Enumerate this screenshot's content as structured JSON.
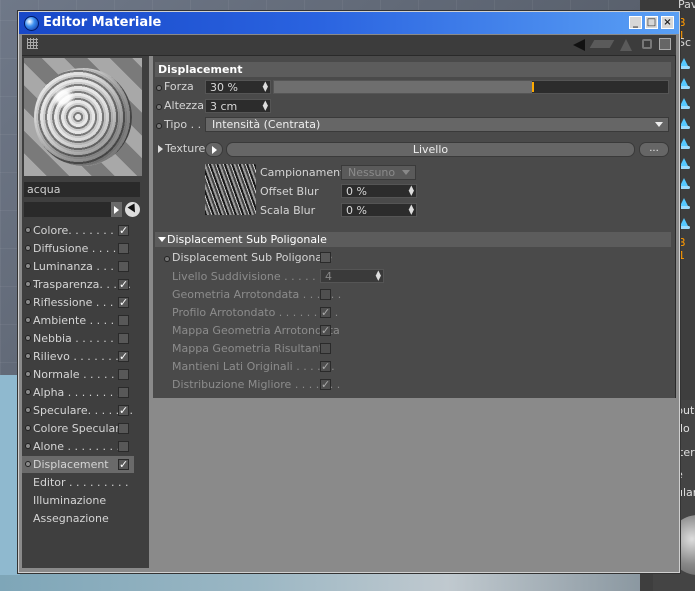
{
  "background": {
    "panel_top_text": "Pav",
    "panel_b_text_1": "B 1",
    "panel_sc_text": "Sc",
    "panel_b_text_2": "B 1",
    "lower_labels": [
      "buti",
      "do",
      "iteria",
      "e",
      "ulare"
    ]
  },
  "window": {
    "title": "Editor Materiale",
    "title_buttons": [
      "_",
      "□",
      "×"
    ]
  },
  "material": {
    "name": "acqua",
    "channels": [
      {
        "label": "Colore. . . . . . . . .",
        "checked": true
      },
      {
        "label": "Diffusione . . . . . .",
        "checked": false
      },
      {
        "label": "Luminanza . . . . . .",
        "checked": false
      },
      {
        "label": "Trasparenza. . . . .",
        "checked": true
      },
      {
        "label": "Riflessione . . . . .",
        "checked": true
      },
      {
        "label": "Ambiente . . . . . . .",
        "checked": false
      },
      {
        "label": "Nebbia . . . . . . . .",
        "checked": false
      },
      {
        "label": "Rilievo . . . . . . . .",
        "checked": true
      },
      {
        "label": "Normale . . . . . . .",
        "checked": false
      },
      {
        "label": "Alpha . . . . . . . . .",
        "checked": false
      },
      {
        "label": "Speculare. . . . . . .",
        "checked": true
      },
      {
        "label": "Colore Speculare",
        "checked": false
      },
      {
        "label": "Alone . . . . . . . . .",
        "checked": false
      },
      {
        "label": "Displacement",
        "checked": true,
        "selected": true
      }
    ],
    "extra_items": [
      "Editor . . . . . . . . .",
      "Illuminazione",
      "Assegnazione"
    ]
  },
  "displacement": {
    "section_title": "Displacement",
    "forza_label": "Forza",
    "forza_value": "30 %",
    "forza_fraction": 0.3,
    "altezza_label": "Altezza",
    "altezza_value": "3 cm",
    "tipo_label": "Tipo . .",
    "tipo_value": "Intensità (Centrata)",
    "texture_label": "Texture",
    "texture_button": "Livello",
    "texture_more": "...",
    "campionamento_label": "Campionamento",
    "campionamento_value": "Nessuno",
    "offset_blur_label": "Offset Blur",
    "offset_blur_value": "0 %",
    "scala_blur_label": "Scala Blur",
    "scala_blur_value": "0 %"
  },
  "subpoly": {
    "section_title": "Displacement Sub Poligonale",
    "enable_label": "Displacement Sub Poligonale",
    "enable_checked": false,
    "livello_label": "Livello Suddivisione . . . . . . . .",
    "livello_value": "4",
    "options": [
      {
        "label": "Geometria Arrotondata . . . . . .",
        "checked": false
      },
      {
        "label": "Profilo Arrotondato . . . . . . . . .",
        "checked": true
      },
      {
        "label": "Mappa Geometria Arrotondata",
        "checked": true
      },
      {
        "label": "Mappa Geometria Risultante",
        "checked": false
      },
      {
        "label": "Mantieni Lati Originali . . . . . .",
        "checked": true
      },
      {
        "label": "Distribuzione Migliore . . . . . . .",
        "checked": true
      }
    ]
  }
}
